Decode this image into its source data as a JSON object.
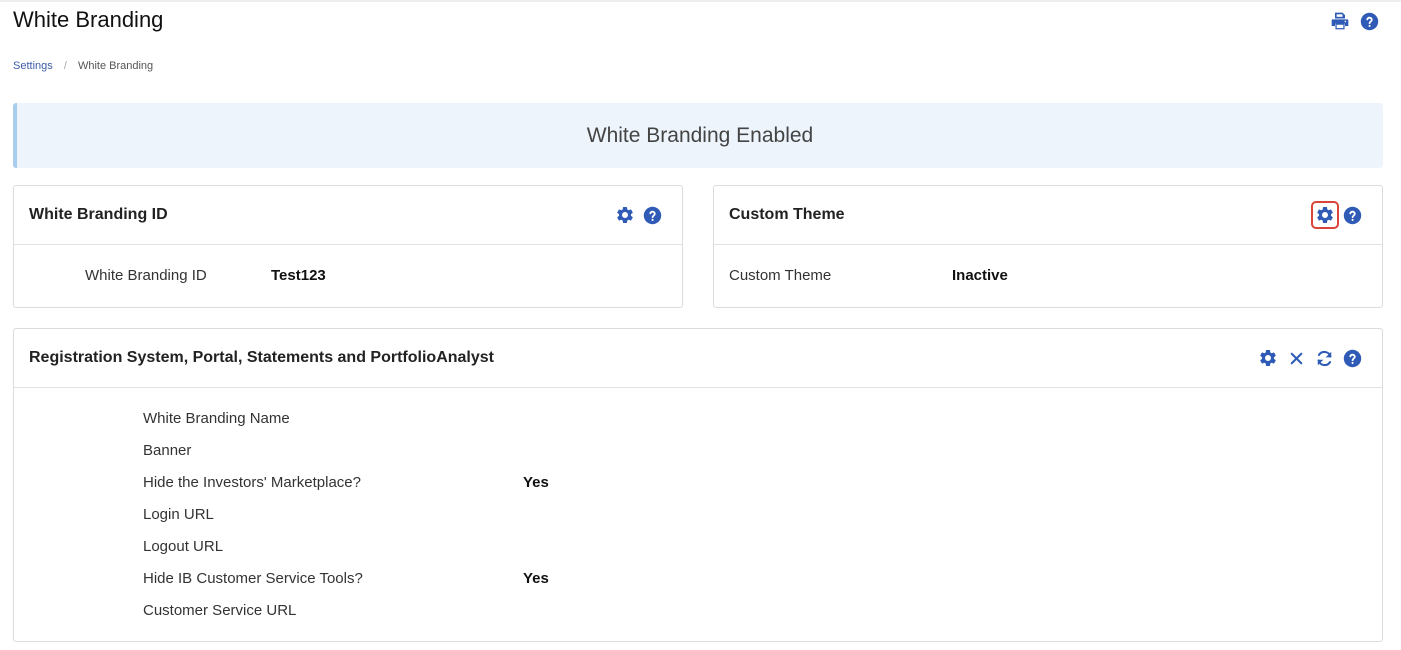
{
  "page": {
    "title": "White Branding"
  },
  "breadcrumb": {
    "items": [
      "Settings",
      "White Branding"
    ]
  },
  "banner": {
    "text": "White Branding Enabled"
  },
  "panels": {
    "white_branding_id": {
      "title": "White Branding ID",
      "rows": [
        {
          "label": "White Branding ID",
          "value": "Test123"
        }
      ]
    },
    "custom_theme": {
      "title": "Custom Theme",
      "rows": [
        {
          "label": "Custom Theme",
          "value": "Inactive"
        }
      ]
    },
    "registration": {
      "title": "Registration System, Portal, Statements and PortfolioAnalyst",
      "rows": [
        {
          "label": "White Branding Name",
          "value": ""
        },
        {
          "label": "Banner",
          "value": ""
        },
        {
          "label": "Hide the Investors' Marketplace?",
          "value": "Yes"
        },
        {
          "label": "Login URL",
          "value": ""
        },
        {
          "label": "Logout URL",
          "value": ""
        },
        {
          "label": "Hide IB Customer Service Tools?",
          "value": "Yes"
        },
        {
          "label": "Customer Service URL",
          "value": ""
        }
      ]
    }
  },
  "colors": {
    "icon_blue": "#2f5bb7",
    "highlight": "#d9453a",
    "banner_bg": "#edf4fc"
  }
}
